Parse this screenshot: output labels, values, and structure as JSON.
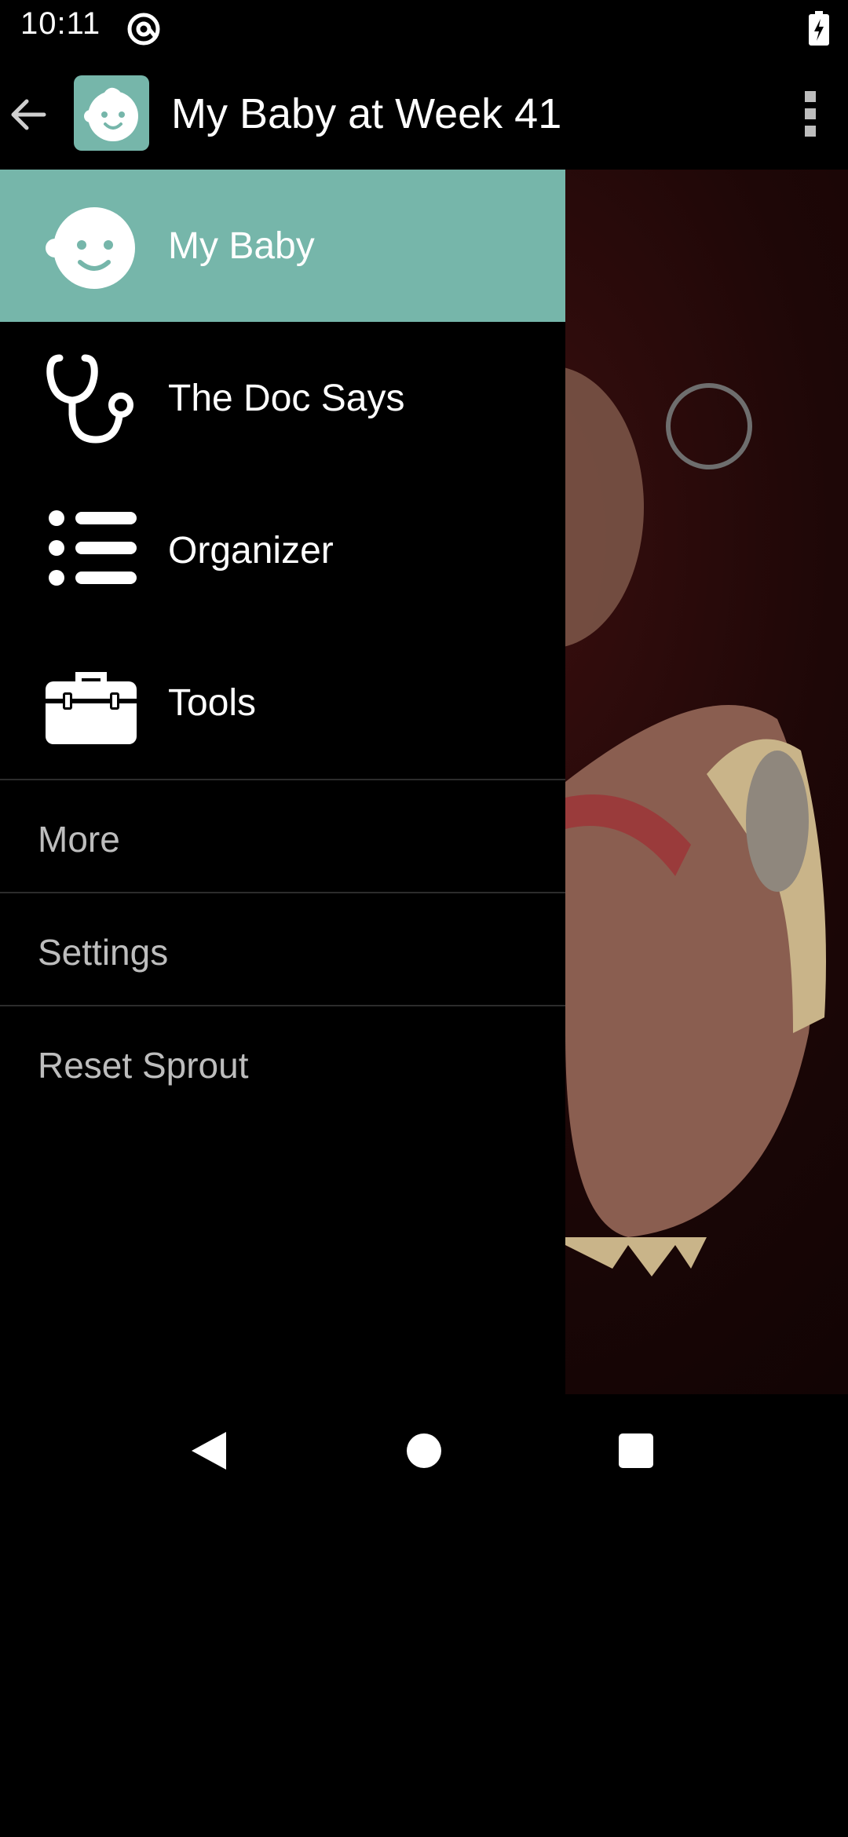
{
  "status_bar": {
    "time": "10:11",
    "notification_icon": "at-sign-icon",
    "battery_icon": "battery-charging-icon"
  },
  "app_bar": {
    "title": "My Baby at Week 41",
    "back_icon": "arrow-left-icon",
    "app_icon": "baby-face-icon",
    "overflow_icon": "more-vert-icon"
  },
  "drawer": {
    "items": [
      {
        "label": "My Baby",
        "icon": "baby-face-icon",
        "selected": true
      },
      {
        "label": "The Doc Says",
        "icon": "stethoscope-icon",
        "selected": false
      },
      {
        "label": "Organizer",
        "icon": "list-icon",
        "selected": false
      },
      {
        "label": "Tools",
        "icon": "toolbox-icon",
        "selected": false
      }
    ],
    "links": [
      {
        "label": "More"
      },
      {
        "label": "Settings"
      },
      {
        "label": "Reset Sprout"
      }
    ]
  },
  "nav_bar": {
    "back_icon": "nav-back-icon",
    "home_icon": "nav-home-icon",
    "recents_icon": "nav-recents-icon"
  },
  "colors": {
    "accent": "#76b6aa",
    "background": "#000000",
    "secondary_text": "#bdbdbd"
  }
}
